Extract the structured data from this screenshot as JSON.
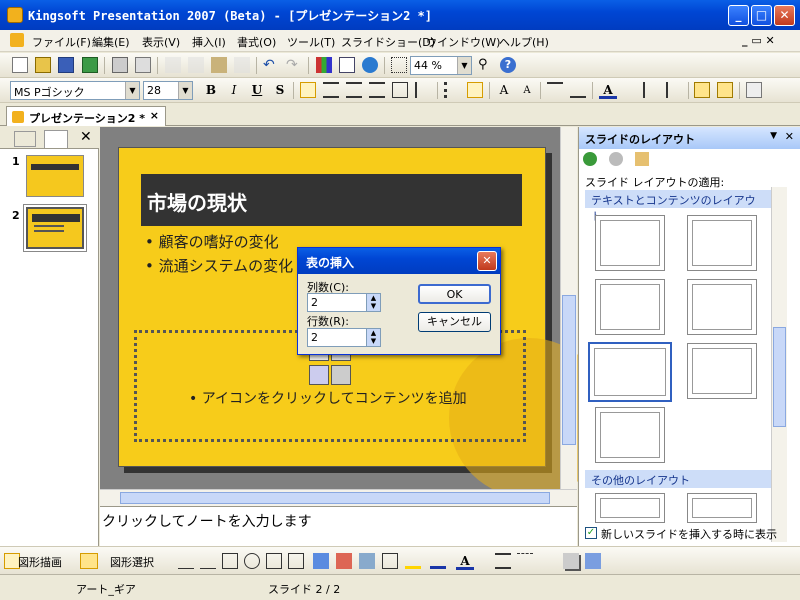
{
  "window": {
    "title": "Kingsoft Presentation 2007 (Beta) - [プレゼンテーション2 *]",
    "minimize": "_",
    "maximize": "□",
    "close": "✕"
  },
  "menu": [
    "ファイル(F)",
    "編集(E)",
    "表示(V)",
    "挿入(I)",
    "書式(O)",
    "ツール(T)",
    "スライドショー(D)",
    "ウインドウ(W)",
    "ヘルプ(H)"
  ],
  "menu_controls": {
    "restore": "_ ▭ ✕"
  },
  "toolbar": {
    "zoom": "44 %"
  },
  "format": {
    "font": "MS Pゴシック",
    "size": "28",
    "bold": "B",
    "italic": "I",
    "underline": "U",
    "shadow": "S"
  },
  "tabs": {
    "document": "プレゼンテーション2 *",
    "close": "×"
  },
  "thumbs": [
    {
      "num": "1"
    },
    {
      "num": "2"
    }
  ],
  "slide": {
    "title": "市場の現状",
    "bullets": [
      "顧客の嗜好の変化",
      "流通システムの変化"
    ],
    "placeholder_text": "アイコンをクリックしてコンテンツを追加"
  },
  "notes": {
    "placeholder": "クリックしてノートを入力します"
  },
  "taskpane": {
    "title": "スライドのレイアウト",
    "apply_label": "スライド レイアウトの適用:",
    "section1": "テキストとコンテンツのレイアウト",
    "section2": "その他のレイアウト",
    "show_checkbox": "新しいスライドを挿入する時に表示"
  },
  "dialog": {
    "title": "表の挿入",
    "cols_label": "列数(C):",
    "cols_value": "2",
    "rows_label": "行数(R):",
    "rows_value": "2",
    "ok": "OK",
    "cancel": "キャンセル"
  },
  "drawbar": {
    "draw": "図形描画",
    "select": "図形選択"
  },
  "status": {
    "art": "アート_ギア",
    "slide": "スライド 2 / 2"
  }
}
